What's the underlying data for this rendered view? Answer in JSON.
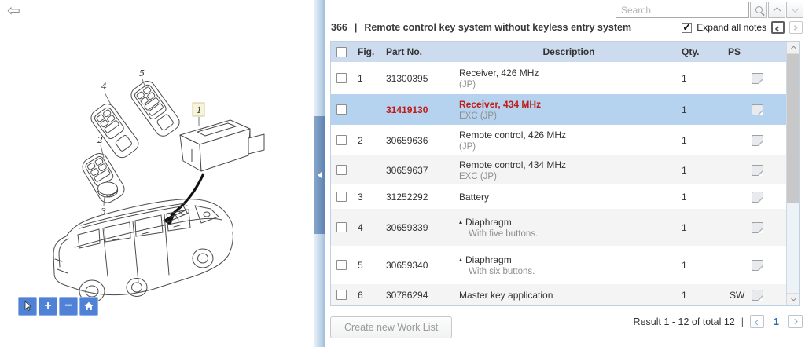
{
  "left_panel": {
    "back_arrow_glyph": "⇦",
    "diagram": {
      "labels": [
        {
          "id": "receiver",
          "text": "1"
        },
        {
          "id": "remote-key",
          "text": "2"
        },
        {
          "id": "battery",
          "text": "3"
        },
        {
          "id": "diaphragm-five",
          "text": "4"
        },
        {
          "id": "diaphragm-six",
          "text": "5"
        }
      ],
      "highlight_color": "#f8f4db"
    },
    "toolbar": {
      "icons": [
        "pointer",
        "zoom-in",
        "zoom-out",
        "home"
      ],
      "zoom_in_glyph": "+",
      "zoom_out_glyph": "−"
    }
  },
  "search": {
    "placeholder": "Search"
  },
  "titlebar": {
    "section_number": "366",
    "separator": "|",
    "title": "Remote control key system without keyless entry system",
    "expand_all_notes_label": "Expand all notes"
  },
  "table": {
    "columns": {
      "fig": "Fig.",
      "part_no": "Part No.",
      "description": "Description",
      "qty": "Qty.",
      "ps": "PS"
    },
    "rows": [
      {
        "fig": "1",
        "part_no": "31300395",
        "description": "Receiver, 426 MHz",
        "note": "(JP)",
        "qty": "1",
        "ps": ""
      },
      {
        "fig": "",
        "part_no": "31419130",
        "description": "Receiver, 434 MHz",
        "note": "EXC (JP)",
        "qty": "1",
        "ps": "",
        "selected": true
      },
      {
        "fig": "2",
        "part_no": "30659636",
        "description": "Remote control, 426 MHz",
        "note": "(JP)",
        "qty": "1",
        "ps": ""
      },
      {
        "fig": "",
        "part_no": "30659637",
        "description": "Remote control, 434 MHz",
        "note": "EXC (JP)",
        "qty": "1",
        "ps": ""
      },
      {
        "fig": "3",
        "part_no": "31252292",
        "description": "Battery",
        "note": "",
        "qty": "1",
        "ps": ""
      },
      {
        "fig": "4",
        "part_no": "30659339",
        "marker": "▴",
        "description": "Diaphragm",
        "note": "With five buttons.",
        "qty": "1",
        "ps": ""
      },
      {
        "fig": "5",
        "part_no": "30659340",
        "marker": "▴",
        "description": "Diaphragm",
        "note": "With six buttons.",
        "qty": "1",
        "ps": ""
      },
      {
        "fig": "6",
        "part_no": "30786294",
        "description": "Master key application",
        "note": "",
        "qty": "1",
        "ps": "SW"
      }
    ]
  },
  "footer": {
    "create_work_list_label": "Create new Work List",
    "result_text": "Result 1 - 12 of total 12",
    "separator": "|",
    "current_page": "1"
  },
  "colors": {
    "header_bg": "#ccdcee",
    "selected_row_bg": "#b5d3ee",
    "alt_row_bg": "#f4f4f4",
    "highlight_red": "#c11b17",
    "toolbar_blue": "#4f81d6",
    "page_number_blue": "#2e6db4"
  }
}
